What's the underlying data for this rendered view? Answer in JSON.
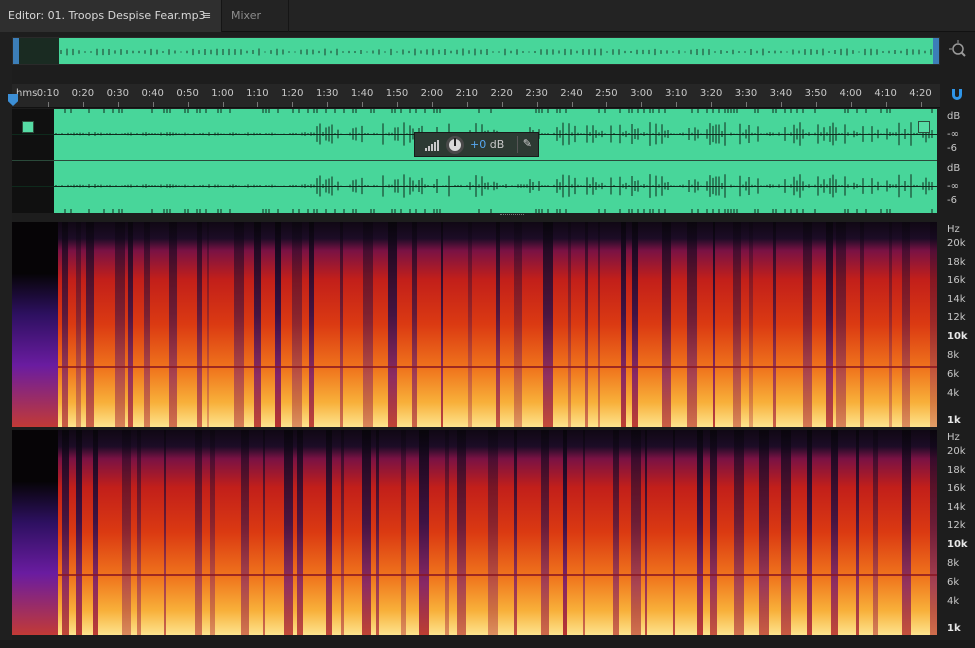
{
  "tabs": [
    {
      "label": "Editor: 01. Troops Despise Fear.mp3",
      "active": true
    },
    {
      "label": "Mixer",
      "active": false
    }
  ],
  "tab_menu_icon": "hamburger-menu-icon",
  "ruler": {
    "unit_label": "hms",
    "ticks": [
      "0:10",
      "0:20",
      "0:30",
      "0:40",
      "0:50",
      "1:00",
      "1:10",
      "1:20",
      "1:30",
      "1:40",
      "1:50",
      "2:00",
      "2:10",
      "2:20",
      "2:30",
      "2:40",
      "2:50",
      "3:00",
      "3:10",
      "3:20",
      "3:30",
      "3:40",
      "3:50",
      "4:00",
      "4:10",
      "4:20"
    ]
  },
  "hud": {
    "volume_value": "+0",
    "volume_unit": "dB",
    "icons": [
      "level-meter-icon",
      "volume-knob-icon",
      "pin-icon"
    ]
  },
  "db_scale": {
    "channel1": [
      "dB",
      "-∞",
      "-6"
    ],
    "channel2": [
      "dB",
      "-∞",
      "-6"
    ]
  },
  "hz_scale": {
    "labels": [
      "Hz",
      "20k",
      "18k",
      "16k",
      "14k",
      "12k",
      "10k",
      "8k",
      "6k",
      "4k",
      "1k"
    ]
  },
  "colors": {
    "waveform": "#48d69a",
    "accent": "#3c8fd6",
    "background": "#1d1d1d"
  }
}
